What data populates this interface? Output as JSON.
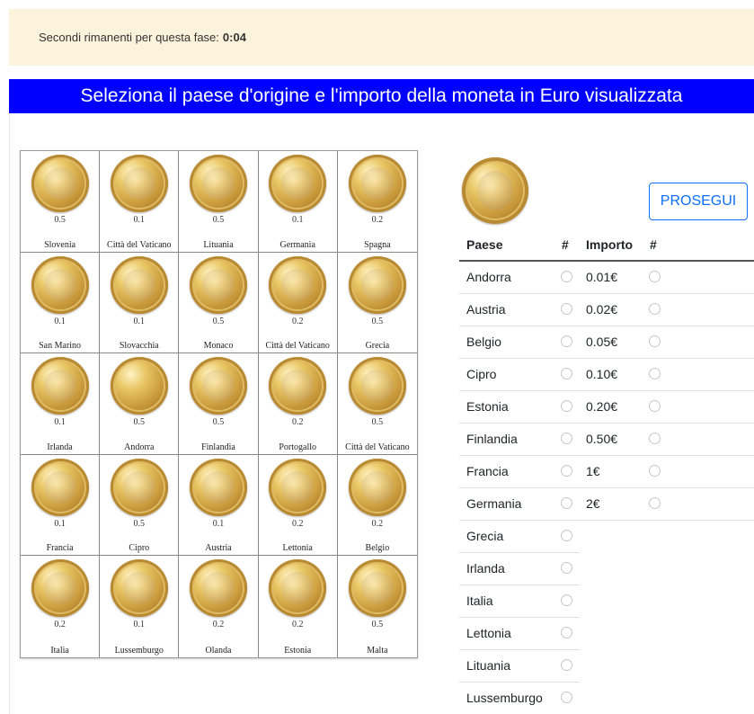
{
  "timer": {
    "label": "Secondi rimanenti per questa fase:",
    "value": "0:04"
  },
  "banner": "Seleziona il paese d'origine e l'importo della moneta in Euro visualizzata",
  "button_label": "PROSEGUI",
  "table_headers": {
    "country": "Paese",
    "hash1": "#",
    "amount": "Importo",
    "hash2": "#"
  },
  "countries": [
    "Andorra",
    "Austria",
    "Belgio",
    "Cipro",
    "Estonia",
    "Finlandia",
    "Francia",
    "Germania",
    "Grecia",
    "Irlanda",
    "Italia",
    "Lettonia",
    "Lituania",
    "Lussemburgo"
  ],
  "amounts": [
    "0.01€",
    "0.02€",
    "0.05€",
    "0.10€",
    "0.20€",
    "0.50€",
    "1€",
    "2€"
  ],
  "coins": [
    {
      "value": "0.5",
      "country": "Slovenia"
    },
    {
      "value": "0.1",
      "country": "Città del Vaticano"
    },
    {
      "value": "0.5",
      "country": "Lituania"
    },
    {
      "value": "0.1",
      "country": "Germania"
    },
    {
      "value": "0.2",
      "country": "Spagna"
    },
    {
      "value": "0.1",
      "country": "San Marino"
    },
    {
      "value": "0.1",
      "country": "Slovacchia"
    },
    {
      "value": "0.5",
      "country": "Monaco"
    },
    {
      "value": "0.2",
      "country": "Città del Vaticano"
    },
    {
      "value": "0.5",
      "country": "Grecia"
    },
    {
      "value": "0.1",
      "country": "Irlanda"
    },
    {
      "value": "0.5",
      "country": "Andorra"
    },
    {
      "value": "0.5",
      "country": "Finlandia"
    },
    {
      "value": "0.2",
      "country": "Portogallo"
    },
    {
      "value": "0.5",
      "country": "Città del Vaticano"
    },
    {
      "value": "0.1",
      "country": "Francia"
    },
    {
      "value": "0.5",
      "country": "Cipro"
    },
    {
      "value": "0.1",
      "country": "Austria"
    },
    {
      "value": "0.2",
      "country": "Lettonia"
    },
    {
      "value": "0.2",
      "country": "Belgio"
    },
    {
      "value": "0.2",
      "country": "Italia"
    },
    {
      "value": "0.1",
      "country": "Lussemburgo"
    },
    {
      "value": "0.2",
      "country": "Olanda"
    },
    {
      "value": "0.2",
      "country": "Estonia"
    },
    {
      "value": "0.5",
      "country": "Malta"
    }
  ]
}
